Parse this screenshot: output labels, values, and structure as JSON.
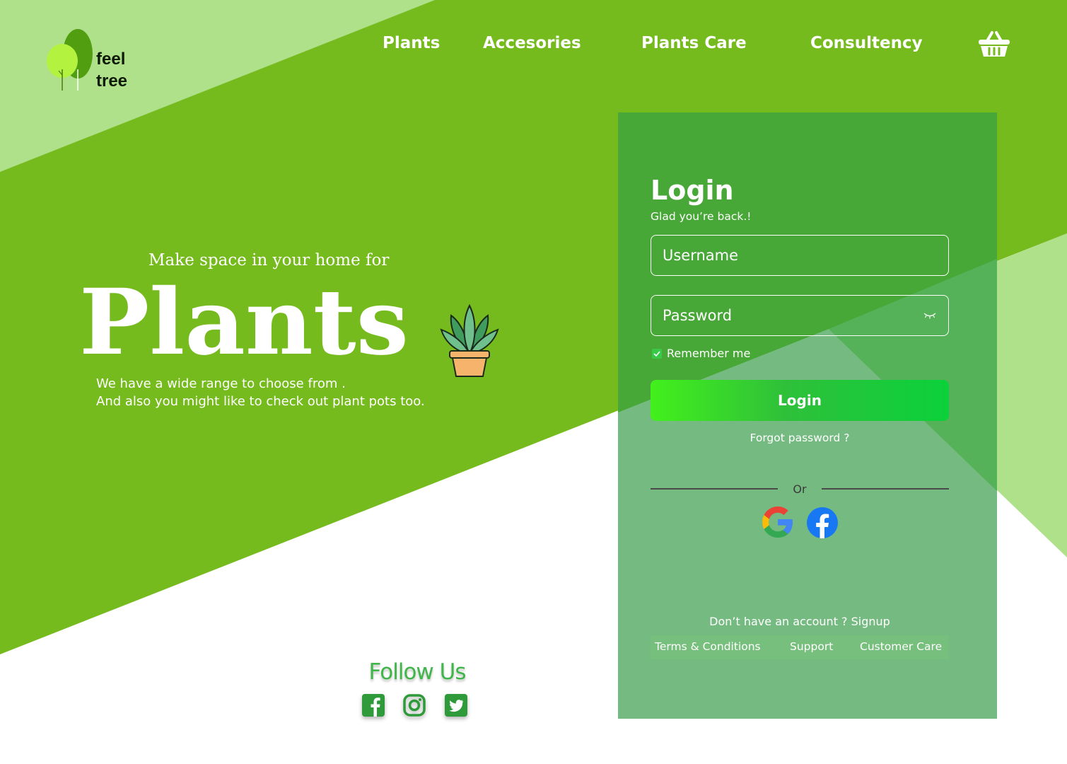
{
  "brand": {
    "line1": "feel",
    "line2": "tree"
  },
  "nav": {
    "items": [
      {
        "label": "Plants"
      },
      {
        "label": "Accesories"
      },
      {
        "label": "Plants Care"
      },
      {
        "label": "Consultency"
      }
    ],
    "cart_icon": "basket-icon"
  },
  "hero": {
    "subtitle": "Make space in your home for",
    "title": "Plants",
    "desc_line1": "We have a wide range to choose from .",
    "desc_line2": "And also you might like to check out plant pots too."
  },
  "follow": {
    "title": "Follow Us",
    "icons": [
      "facebook-icon",
      "instagram-icon",
      "twitter-icon"
    ]
  },
  "login": {
    "title": "Login",
    "subtitle": "Glad you’re back.!",
    "username_placeholder": "Username",
    "password_placeholder": "Password",
    "remember_label": "Remember me",
    "remember_checked": true,
    "button_label": "Login",
    "forgot_label": "Forgot password ?",
    "or_label": "Or",
    "social_icons": [
      "google-icon",
      "facebook-icon"
    ],
    "signup_label": "Don’t have an account ? Signup",
    "footer_links": [
      {
        "label": "Terms & Conditions"
      },
      {
        "label": "Support"
      },
      {
        "label": "Customer Care"
      }
    ]
  },
  "colors": {
    "primary_green": "#76bb1e",
    "light_green": "#afe08a",
    "panel_green": "#47a737",
    "panel_light": "#75bb81",
    "follow_green": "#3fb54a"
  }
}
